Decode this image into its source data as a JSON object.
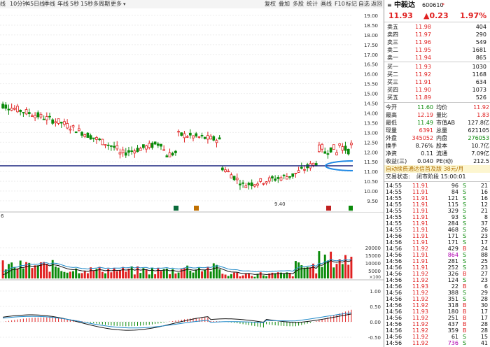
{
  "toolbar": {
    "periods": [
      "线",
      "10分钟",
      "45日线",
      "季线",
      "年线",
      "5秒",
      "15秒",
      "多周期",
      "更多"
    ],
    "tools": [
      "叠加",
      "多股",
      "统计",
      "画线",
      "F10",
      "标记",
      "自选",
      "返回"
    ],
    "tool_first": "复权"
  },
  "stock": {
    "name": "中毅达",
    "code": "600610",
    "price": "11.93",
    "change": "▲0.23",
    "pct": "1.97%"
  },
  "price_axis": [
    "19.00",
    "18.50",
    "18.00",
    "17.50",
    "17.00",
    "16.50",
    "16.00",
    "15.50",
    "15.00",
    "14.50",
    "14.00",
    "13.50",
    "13.00",
    "12.50",
    "12.00",
    "11.50",
    "11.00",
    "10.50",
    "10.00",
    "9.50"
  ],
  "chart_markers": {
    "low_label": "9.40",
    "vol_label": "6"
  },
  "vol_axis": [
    "20000",
    "15000",
    "10000",
    "5000"
  ],
  "vol_unit": "×100",
  "macd_axis": [
    "1.00",
    "0.50",
    "0.00",
    "-0.50"
  ],
  "asks": [
    {
      "label": "卖五",
      "price": "11.98",
      "vol": "404"
    },
    {
      "label": "卖四",
      "price": "11.97",
      "vol": "290"
    },
    {
      "label": "卖三",
      "price": "11.96",
      "vol": "549"
    },
    {
      "label": "卖二",
      "price": "11.95",
      "vol": "1681"
    },
    {
      "label": "卖一",
      "price": "11.94",
      "vol": "865"
    }
  ],
  "bids": [
    {
      "label": "买一",
      "price": "11.93",
      "vol": "1030"
    },
    {
      "label": "买二",
      "price": "11.92",
      "vol": "1168"
    },
    {
      "label": "买三",
      "price": "11.91",
      "vol": "634"
    },
    {
      "label": "买四",
      "price": "11.90",
      "vol": "1073"
    },
    {
      "label": "买五",
      "price": "11.89",
      "vol": "526"
    }
  ],
  "stats": [
    {
      "l1": "今开",
      "v1": "11.60",
      "l2": "均价",
      "v2": "11.92",
      "c1": "grn",
      "c2": "red"
    },
    {
      "l1": "最高",
      "v1": "12.19",
      "l2": "量比",
      "v2": "1.83",
      "c1": "red",
      "c2": "red"
    },
    {
      "l1": "最低",
      "v1": "11.49",
      "l2": "市值AB",
      "v2": "127.8亿",
      "c1": "grn",
      "c2": "blk"
    },
    {
      "l1": "现量",
      "v1": "6391",
      "l2": "总量",
      "v2": "621105",
      "c1": "red",
      "c2": "blk"
    },
    {
      "l1": "外盘",
      "v1": "345052",
      "l2": "内盘",
      "v2": "276053",
      "c1": "red",
      "c2": "grn"
    },
    {
      "l1": "换手",
      "v1": "8.76%",
      "l2": "股本",
      "v2": "10.7亿",
      "c1": "blk",
      "c2": "blk"
    },
    {
      "l1": "净资",
      "v1": "0.11",
      "l2": "流通",
      "v2": "7.09亿",
      "c1": "blk",
      "c2": "blk"
    },
    {
      "l1": "收益(三)",
      "v1": "0.040",
      "l2": "PE(动)",
      "v2": "212.5",
      "c1": "blk",
      "c2": "blk"
    }
  ],
  "promo": "自动续费通达信首及版 38元/月",
  "status": {
    "label": "交易状态:",
    "value": "闭市阶段 15:00:01"
  },
  "trades": [
    {
      "t": "14:55",
      "p": "11.91",
      "v": "96",
      "d": "S",
      "n": "21"
    },
    {
      "t": "14:55",
      "p": "11.91",
      "v": "84",
      "d": "S",
      "n": "16"
    },
    {
      "t": "14:55",
      "p": "11.91",
      "v": "121",
      "d": "S",
      "n": "16"
    },
    {
      "t": "14:55",
      "p": "11.91",
      "v": "115",
      "d": "S",
      "n": "12"
    },
    {
      "t": "14:55",
      "p": "11.91",
      "v": "329",
      "d": "S",
      "n": "21"
    },
    {
      "t": "14:55",
      "p": "11.91",
      "v": "93",
      "d": "S",
      "n": "8"
    },
    {
      "t": "14:55",
      "p": "11.91",
      "v": "284",
      "d": "S",
      "n": "37"
    },
    {
      "t": "14:55",
      "p": "11.91",
      "v": "468",
      "d": "S",
      "n": "26"
    },
    {
      "t": "14:56",
      "p": "11.91",
      "v": "171",
      "d": "S",
      "n": "23"
    },
    {
      "t": "14:56",
      "p": "11.91",
      "v": "171",
      "d": "S",
      "n": "17"
    },
    {
      "t": "14:56",
      "p": "11.92",
      "v": "429",
      "d": "B",
      "n": "24"
    },
    {
      "t": "14:56",
      "p": "11.91",
      "v": "864",
      "d": "S",
      "n": "88"
    },
    {
      "t": "14:56",
      "p": "11.91",
      "v": "281",
      "d": "S",
      "n": "25"
    },
    {
      "t": "14:56",
      "p": "11.91",
      "v": "252",
      "d": "S",
      "n": "23"
    },
    {
      "t": "14:56",
      "p": "11.92",
      "v": "326",
      "d": "B",
      "n": "27"
    },
    {
      "t": "14:56",
      "p": "11.92",
      "v": "124",
      "d": "S",
      "n": "23"
    },
    {
      "t": "14:56",
      "p": "11.93",
      "v": "22",
      "d": "B",
      "n": "6"
    },
    {
      "t": "14:56",
      "p": "11.92",
      "v": "388",
      "d": "S",
      "n": "29"
    },
    {
      "t": "14:56",
      "p": "11.92",
      "v": "351",
      "d": "S",
      "n": "28"
    },
    {
      "t": "14:56",
      "p": "11.92",
      "v": "318",
      "d": "B",
      "n": "30"
    },
    {
      "t": "14:56",
      "p": "11.93",
      "v": "180",
      "d": "B",
      "n": "17"
    },
    {
      "t": "14:56",
      "p": "11.92",
      "v": "251",
      "d": "B",
      "n": "17"
    },
    {
      "t": "14:56",
      "p": "11.92",
      "v": "437",
      "d": "B",
      "n": "28"
    },
    {
      "t": "14:56",
      "p": "11.92",
      "v": "359",
      "d": "B",
      "n": "28"
    },
    {
      "t": "14:56",
      "p": "11.92",
      "v": "61",
      "d": "S",
      "n": "15"
    },
    {
      "t": "14:56",
      "p": "11.92",
      "v": "736",
      "d": "S",
      "n": "41"
    }
  ],
  "colors": {
    "up": "#e02020",
    "down": "#0a8a0a",
    "support": "#1a237e",
    "ellipse": "#1e88e5",
    "arrow": "#e02020"
  }
}
